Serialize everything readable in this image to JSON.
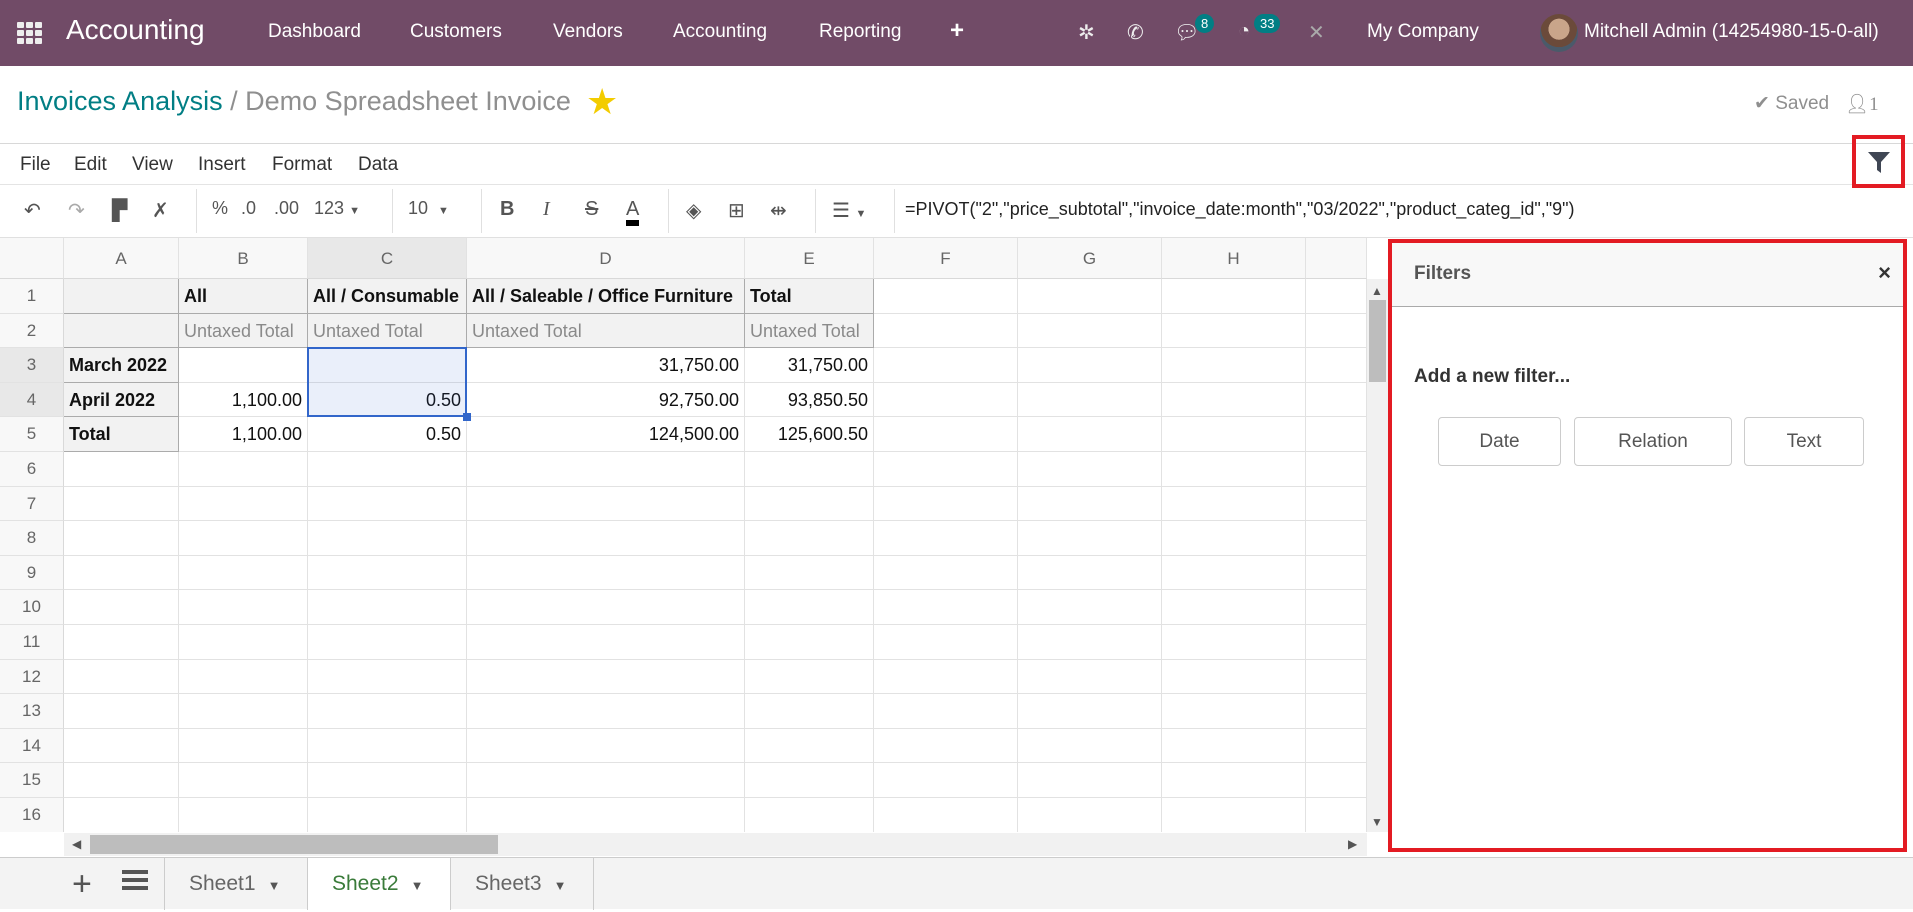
{
  "navbar": {
    "app_title": "Accounting",
    "menu": [
      "Dashboard",
      "Customers",
      "Vendors",
      "Accounting",
      "Reporting"
    ],
    "plus_icon": "+",
    "messages_count": "8",
    "activities_count": "33",
    "company": "My Company",
    "user": "Mitchell Admin (14254980-15-0-all)",
    "brand_color": "#714b67"
  },
  "breadcrumb": {
    "parent": "Invoices Analysis",
    "separator": "/",
    "current": "Demo Spreadsheet Invoice"
  },
  "status": {
    "saved": "✔ Saved",
    "collaborators": "1"
  },
  "menubar": [
    "File",
    "Edit",
    "View",
    "Insert",
    "Format",
    "Data"
  ],
  "toolbar": {
    "percent": "%",
    "dec_decrease": ".0",
    "dec_increase": ".00",
    "format": "123",
    "font_size": "10",
    "bold": "B",
    "italic": "I",
    "strike": "S",
    "text_color": "A"
  },
  "formula": "=PIVOT(\"2\",\"price_subtotal\",\"invoice_date:month\",\"03/2022\",\"product_categ_id\",\"9\")",
  "grid": {
    "columns": [
      "A",
      "B",
      "C",
      "D",
      "E",
      "F",
      "G",
      "H"
    ],
    "rows": [
      "1",
      "2",
      "3",
      "4",
      "5",
      "6",
      "7",
      "8",
      "9",
      "10",
      "11",
      "12",
      "13",
      "14",
      "15",
      "16"
    ],
    "cells": {
      "B1": "All",
      "C1": "All / Consumable",
      "D1": "All / Saleable / Office Furniture",
      "E1": "Total",
      "B2": "Untaxed Total",
      "C2": "Untaxed Total",
      "D2": "Untaxed Total",
      "E2": "Untaxed Total",
      "A3": "March 2022",
      "B3": "",
      "C3": "",
      "D3": "31,750.00",
      "E3": "31,750.00",
      "A4": "April 2022",
      "B4": "1,100.00",
      "C4": "0.50",
      "D4": "92,750.00",
      "E4": "93,850.50",
      "A5": "Total",
      "B5": "1,100.00",
      "C5": "0.50",
      "D5": "124,500.00",
      "E5": "125,600.50"
    },
    "selection": "C3:C4"
  },
  "sheets": {
    "tabs": [
      "Sheet1",
      "Sheet2",
      "Sheet3"
    ],
    "active": "Sheet2"
  },
  "filters_panel": {
    "title": "Filters",
    "close": "×",
    "add_label": "Add a new filter...",
    "buttons": [
      "Date",
      "Relation",
      "Text"
    ]
  }
}
